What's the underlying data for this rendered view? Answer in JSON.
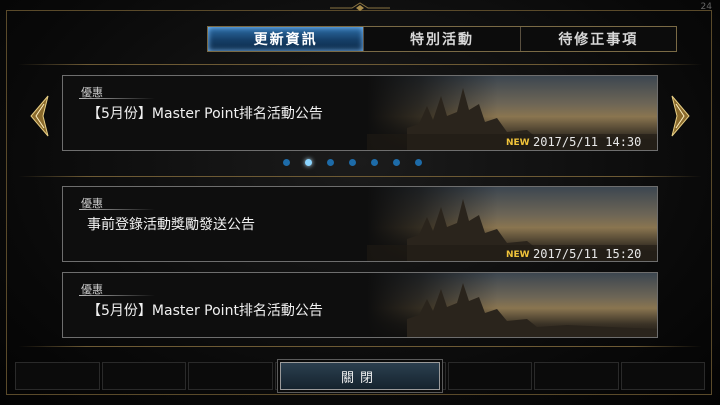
{
  "status_text": "24",
  "tabs": [
    {
      "label": "更新資訊",
      "active": true
    },
    {
      "label": "特別活動",
      "active": false
    },
    {
      "label": "待修正事項",
      "active": false
    }
  ],
  "cards": [
    {
      "tag": "優惠",
      "title": "【5月份】Master Point排名活動公告",
      "new": "NEW",
      "date": "2017/5/11 14:30"
    },
    {
      "tag": "優惠",
      "title": "事前登錄活動獎勵發送公告",
      "new": "NEW",
      "date": "2017/5/11 15:20"
    },
    {
      "tag": "優惠",
      "title": "【5月份】Master Point排名活動公告",
      "new": "",
      "date": ""
    }
  ],
  "pagination": {
    "total": 7,
    "current": 2
  },
  "close_label": "關閉",
  "bottom_bar": [
    "",
    "",
    "",
    "",
    "",
    "",
    "",
    ""
  ],
  "colors": {
    "accent_blue": "#1d6ba8",
    "new_badge": "#f0c33a",
    "gold_frame": "#6d5a34"
  }
}
